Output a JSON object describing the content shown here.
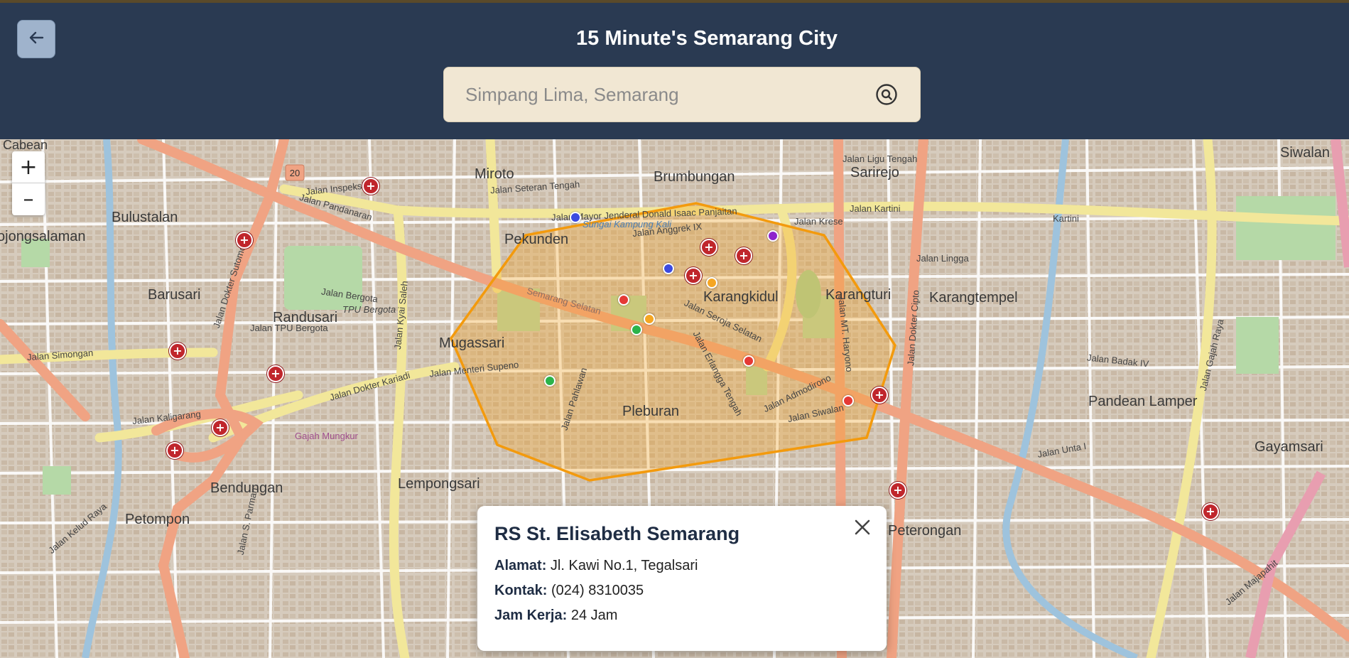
{
  "header": {
    "title": "15 Minute's Semarang City",
    "search_placeholder": "Simpang Lima, Semarang",
    "back_icon": "arrow-left-icon",
    "search_icon": "search-circle-icon"
  },
  "map": {
    "zoom_in": "+",
    "zoom_out": "–",
    "accent_area_color": "#f5a623",
    "place_labels": [
      "Cabean",
      "Miroto",
      "Brumbungan",
      "Sarirejo",
      "Siwalan",
      "Bulustalan",
      "Pekunden",
      "ojongsalaman",
      "Barusari",
      "Randusari",
      "Karangkidul",
      "Karangturi",
      "Karangtempel",
      "Mugassari",
      "Pleburan",
      "Pandean Lamper",
      "Gayamsari",
      "Bendungan",
      "Petompon",
      "Lempongsari",
      "Peterongan",
      "TPU Bergota",
      "Gajah Mungkur"
    ],
    "street_labels": [
      "Jalan Pandanaran",
      "Jalan Mayor Jenderal Donald Isaac Panjaitan",
      "Jalan Kartini",
      "Kartini",
      "Jalan Menteri Supeno",
      "Jalan Dokter Kariadi",
      "Jalan Kaligarang",
      "Jalan Simongan",
      "Jalan Kyai Saleh",
      "Jalan Dokter Sutomo",
      "Jalan MT. Haryono",
      "Jalan Dokter Cipto",
      "Jalan Seroja Selatan",
      "Jalan Pahlawan",
      "Jalan Admodirono",
      "Jalan Siwalan",
      "Jalan Gajah Raya",
      "Jalan Majapahit",
      "Jalan Anggrek IX",
      "Sungai Kampung Kali",
      "Semarang Selatan",
      "Jalan Erlangga Tengah",
      "Jalan Bergota",
      "Jalan TPU Bergota",
      "Jalan Inspeksi",
      "Jalan Seteran Tengah",
      "Jalan Ligu Tengah",
      "Jalan Krese",
      "Jalan Lingga",
      "Jalan Badak IV",
      "Jalan Unta I",
      "Jalan Kelud Raya",
      "Jalan S. Parman"
    ],
    "route_badge": "20"
  },
  "popup": {
    "title": "RS St. Elisabeth Semarang",
    "alamat_label": "Alamat:",
    "alamat_value": "Jl. Kawi No.1, Tegalsari",
    "kontak_label": "Kontak:",
    "kontak_value": "(024) 8310035",
    "jam_label": "Jam Kerja:",
    "jam_value": "24 Jam",
    "close_icon": "close-icon"
  }
}
